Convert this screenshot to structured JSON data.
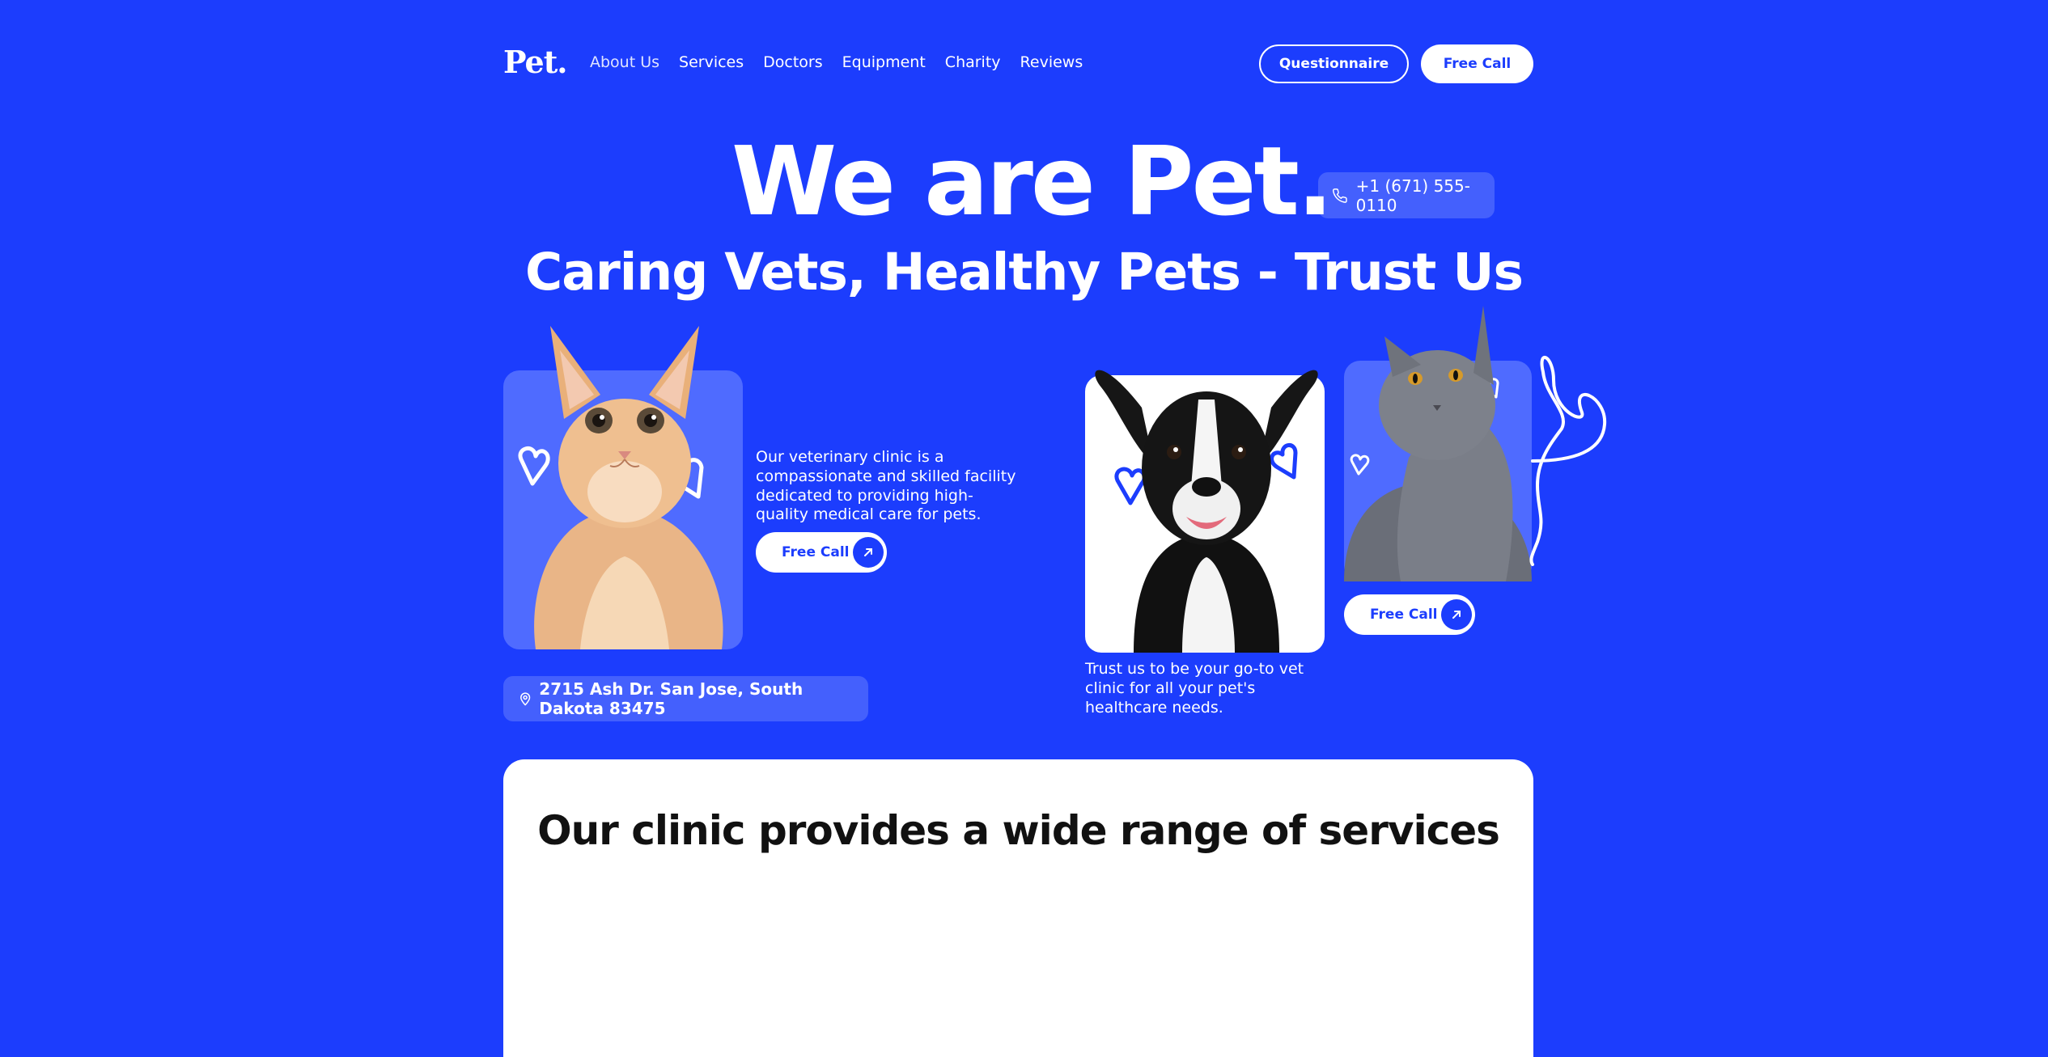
{
  "header": {
    "logo": "Pet.",
    "nav": [
      "About Us",
      "Services",
      "Doctors",
      "Equipment",
      "Charity",
      "Reviews"
    ],
    "questionnaire_label": "Questionnaire",
    "free_call_label": "Free Call"
  },
  "hero": {
    "title": "We are Pet.",
    "phone": "+1 (671) 555-0110",
    "subtitle": "Caring Vets, Healthy Pets - Trust Us",
    "description_1": "Our veterinary clinic is a compassionate and skilled facility dedicated to providing high-quality medical care for pets.",
    "cta_1": "Free Call",
    "description_2": "Trust us to be your go-to vet clinic for all your pet's healthcare needs.",
    "cta_2": "Free Call",
    "address": "2715 Ash Dr. San Jose, South Dakota 83475"
  },
  "services": {
    "title": "Our clinic provides a wide range of services"
  },
  "colors": {
    "brand_blue": "#1c3dfd",
    "card_blue": "#4f6bff",
    "white": "#ffffff"
  },
  "icons": [
    "phone-icon",
    "location-pin-icon",
    "arrow-up-right-icon",
    "heart-icon"
  ]
}
